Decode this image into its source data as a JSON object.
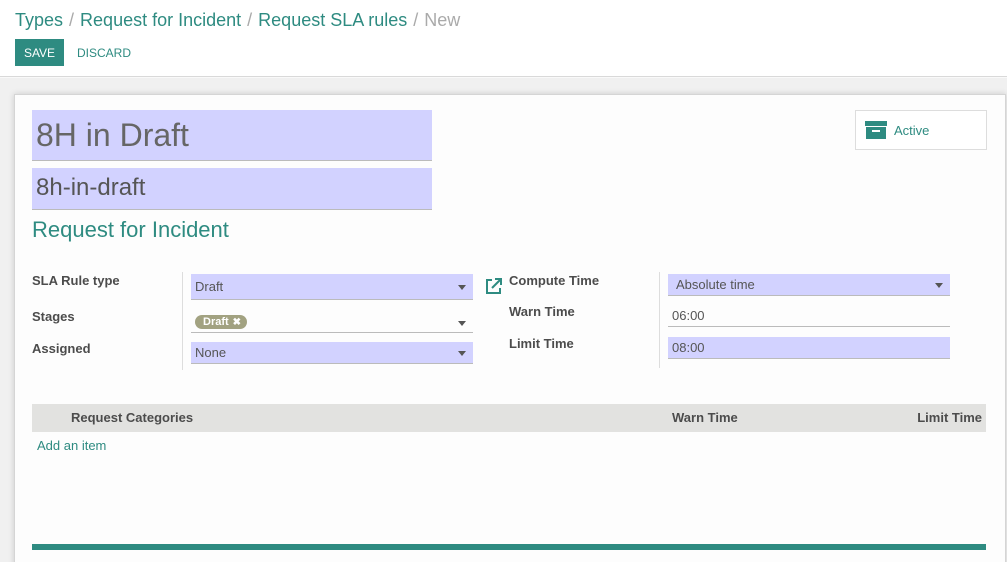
{
  "breadcrumb": {
    "items": [
      "Types",
      "Request for Incident",
      "Request SLA rules"
    ],
    "separator": "/",
    "current": "New"
  },
  "toolbar": {
    "save_label": "SAVE",
    "discard_label": "DISCARD"
  },
  "record": {
    "name": "8H in Draft",
    "code": "8h-in-draft",
    "request_type": "Request for Incident",
    "active_label": "Active"
  },
  "fields": {
    "sla_rule_type": {
      "label": "SLA Rule type",
      "value": "Draft"
    },
    "stages": {
      "label": "Stages",
      "tags": [
        "Draft"
      ]
    },
    "assigned": {
      "label": "Assigned",
      "value": "None"
    },
    "compute_time": {
      "label": "Compute Time",
      "value": "Absolute time"
    },
    "warn_time": {
      "label": "Warn Time",
      "value": "06:00"
    },
    "limit_time": {
      "label": "Limit Time",
      "value": "08:00"
    }
  },
  "categories_table": {
    "columns": [
      "Request Categories",
      "Warn Time",
      "Limit Time"
    ],
    "add_item_label": "Add an item"
  },
  "colors": {
    "accent": "#2e8b81",
    "required_field": "#d2d2ff",
    "tag": "#a2a281"
  }
}
